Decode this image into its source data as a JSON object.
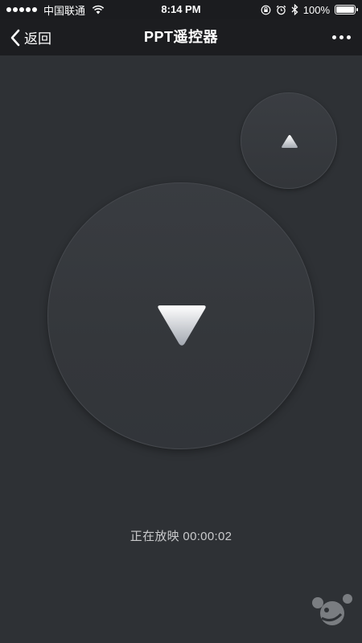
{
  "statusbar": {
    "carrier": "中国联通",
    "time": "8:14 PM",
    "battery": "100%",
    "battery_level": 1.0,
    "icons": [
      "signal-icon",
      "wifi-icon",
      "lock-rotation-icon",
      "alarm-icon",
      "bluetooth-icon",
      "battery-icon"
    ]
  },
  "navbar": {
    "back_label": "返回",
    "title": "PPT遥控器",
    "more_icon": "more-icon"
  },
  "remote": {
    "prev_icon": "triangle-up-icon",
    "next_icon": "triangle-down-icon",
    "status_text": "正在放映 00:00:02"
  },
  "colors": {
    "background": "#2e3135",
    "navbar": "#1c1d20",
    "button": "#383b40",
    "text": "#ffffff",
    "status_text": "#c9cacc"
  }
}
